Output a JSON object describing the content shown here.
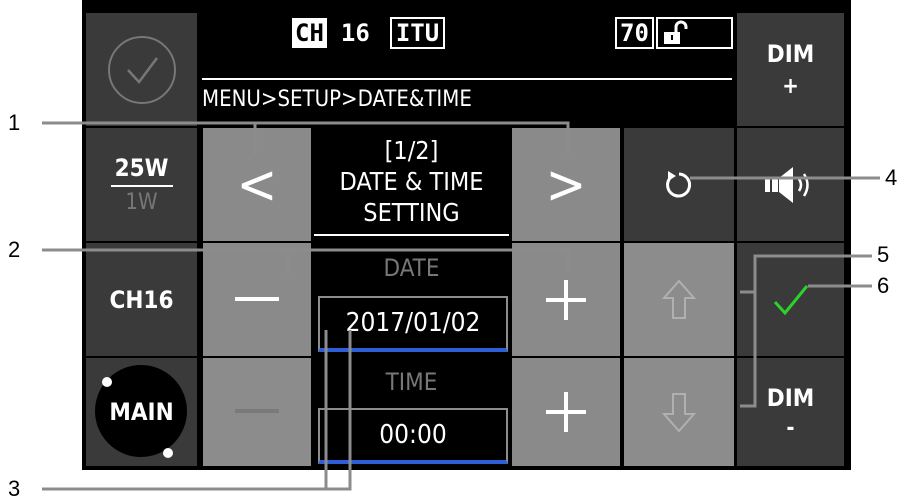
{
  "status": {
    "channel_label": "CH",
    "channel_number": "16",
    "channel_mode": "ITU",
    "volume_level": "70"
  },
  "breadcrumb": "MENU>SETUP>DATE&TIME",
  "page": {
    "indicator": "[1/2]",
    "title_line1": "DATE & TIME",
    "title_line2": "SETTING"
  },
  "left_panel": {
    "power_high": "25W",
    "power_low": "1W",
    "channel_button": "CH16",
    "main_button": "MAIN"
  },
  "right_panel": {
    "dim_plus_label": "DIM",
    "dim_plus_symbol": "+",
    "dim_minus_label": "DIM",
    "dim_minus_symbol": "-"
  },
  "nav": {
    "prev_symbol": "<",
    "next_symbol": ">"
  },
  "date": {
    "label": "DATE",
    "value": "2017/01/02"
  },
  "time": {
    "label": "TIME",
    "value": "00:00"
  },
  "callouts": [
    "1",
    "2",
    "3",
    "4",
    "5",
    "6"
  ],
  "colors": {
    "accent_blue": "#2f5fd6",
    "confirm_green": "#2bd22b"
  }
}
